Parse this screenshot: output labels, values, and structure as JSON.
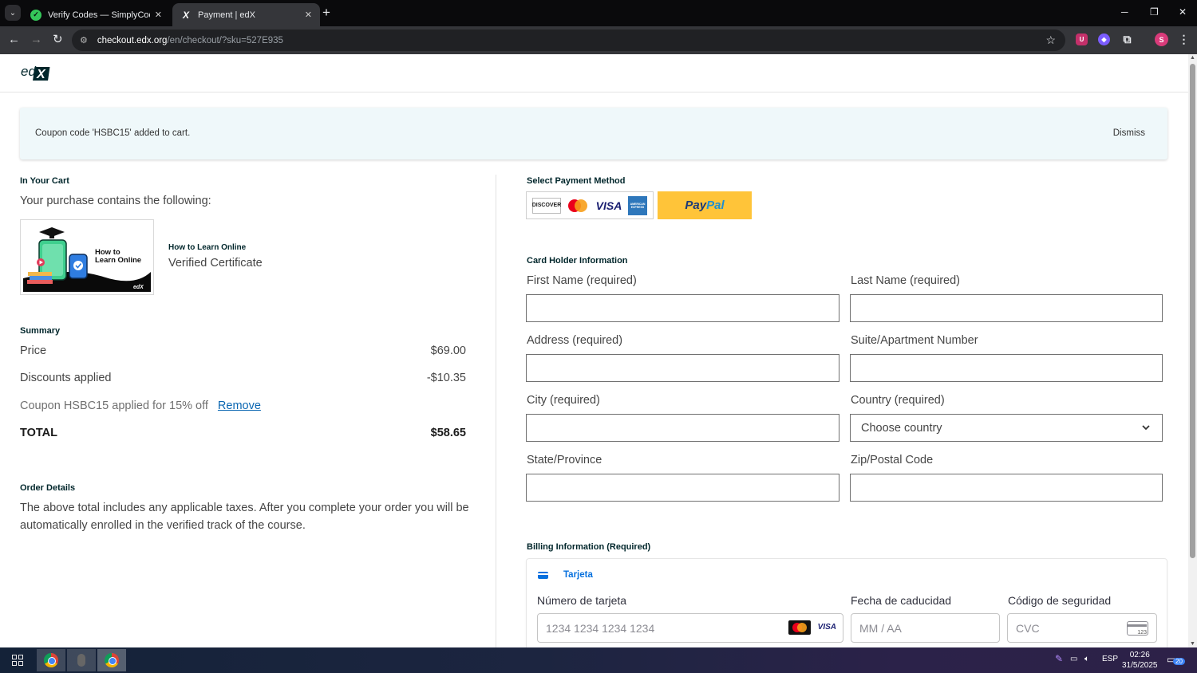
{
  "browser": {
    "tabs": [
      {
        "label": "Verify Codes — SimplyCodes",
        "active": false
      },
      {
        "label": "Payment | edX",
        "active": true
      }
    ],
    "url_host": "checkout.edx.org",
    "url_path": "/en/checkout/?sku=527E935",
    "profile_initial": "S"
  },
  "header": {
    "logo_text": "edX"
  },
  "alert": {
    "message": "Coupon code 'HSBC15' added to cart.",
    "dismiss_label": "Dismiss"
  },
  "cart": {
    "heading": "In Your Cart",
    "subheading": "Your purchase contains the following:",
    "item": {
      "image_text": "How to Learn Online",
      "title": "How to Learn Online",
      "type": "Verified Certificate"
    }
  },
  "summary": {
    "heading": "Summary",
    "price_label": "Price",
    "price_value": "$69.00",
    "discount_label": "Discounts applied",
    "discount_value": "-$10.35",
    "coupon_text": "Coupon HSBC15 applied for 15% off",
    "remove_label": "Remove",
    "total_label": "TOTAL",
    "total_value": "$58.65"
  },
  "order_details": {
    "heading": "Order Details",
    "text_line1": "The above total includes any applicable taxes. After you complete your order you will be",
    "text_line2": "automatically enrolled in the verified track of the course."
  },
  "payment": {
    "heading": "Select Payment Method",
    "card_logos": [
      "DISCOVER",
      "mastercard",
      "VISA",
      "AMERICAN EXPRESS"
    ],
    "paypal_pay": "Pay",
    "paypal_pal": "Pal"
  },
  "card_holder": {
    "heading": "Card Holder Information",
    "first_name_label": "First Name (required)",
    "last_name_label": "Last Name (required)",
    "address_label": "Address (required)",
    "suite_label": "Suite/Apartment Number",
    "city_label": "City (required)",
    "country_label": "Country (required)",
    "country_value": "Choose country",
    "state_label": "State/Province",
    "zip_label": "Zip/Postal Code"
  },
  "billing": {
    "heading": "Billing Information (Required)",
    "tab_label": "Tarjeta",
    "card_number_label": "Número de tarjeta",
    "card_number_placeholder": "1234 1234 1234 1234",
    "expiry_label": "Fecha de caducidad",
    "expiry_placeholder": "MM / AA",
    "cvc_label": "Código de seguridad",
    "cvc_placeholder": "CVC",
    "cvc_icon_text": "123",
    "visa_text": "VISA"
  },
  "taskbar": {
    "language": "ESP",
    "time": "02:26",
    "date": "31/5/2025",
    "notifications": "20"
  }
}
